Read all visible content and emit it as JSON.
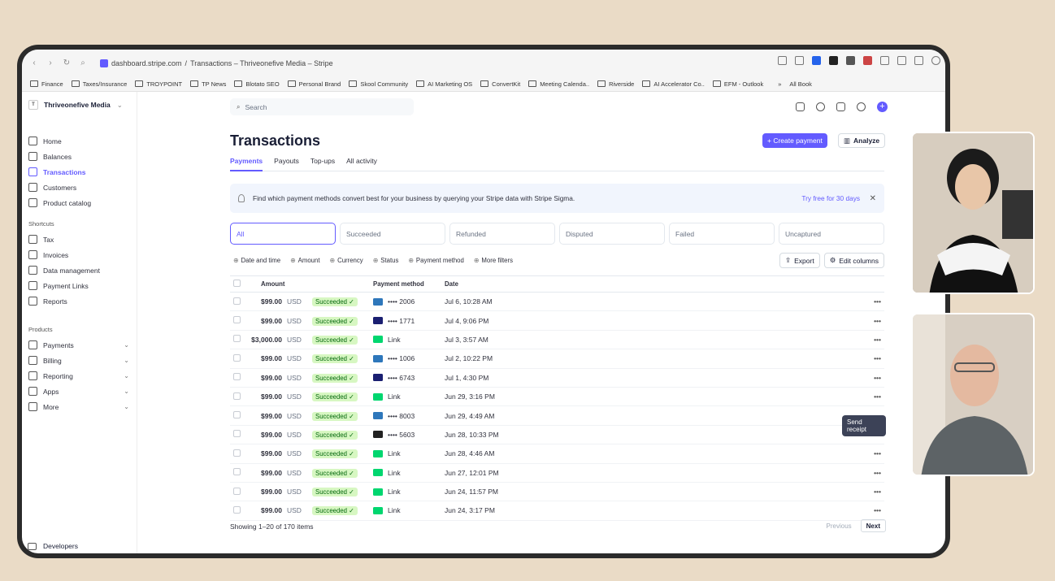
{
  "browser": {
    "url": "dashboard.stripe.com",
    "title": "Transactions – Thriveonefive Media – Stripe",
    "separator": "/"
  },
  "bookmarks": [
    "Finance",
    "Taxes/Insurance",
    "TROYPOINT",
    "TP News",
    "Blotato SEO",
    "Personal Brand",
    "Skool Community",
    "AI Marketing OS",
    "ConvertKit",
    "Meeting Calenda..",
    "Riverside",
    "AI Accelerator Co..",
    "EFM - Outlook"
  ],
  "bookmarks_more": "»",
  "bookmarks_all": "All Book",
  "account": {
    "initial": "T",
    "name": "Thriveonefive Media"
  },
  "nav": [
    "Home",
    "Balances",
    "Transactions",
    "Customers",
    "Product catalog"
  ],
  "shortcuts_label": "Shortcuts",
  "shortcuts": [
    "Tax",
    "Invoices",
    "Data management",
    "Payment Links",
    "Reports"
  ],
  "products_label": "Products",
  "products": [
    "Payments",
    "Billing",
    "Reporting",
    "Apps",
    "More"
  ],
  "developers": "Developers",
  "search_placeholder": "Search",
  "page_title": "Transactions",
  "create_payment": "+ Create payment",
  "analyze": "Analyze",
  "tabs": [
    "Payments",
    "Payouts",
    "Top-ups",
    "All activity"
  ],
  "banner": {
    "text": "Find which payment methods convert best for your business by querying your Stripe data with Stripe Sigma.",
    "link": "Try free for 30 days",
    "close": "✕"
  },
  "filters": [
    "All",
    "Succeeded",
    "Refunded",
    "Disputed",
    "Failed",
    "Uncaptured"
  ],
  "chips": [
    "Date and time",
    "Amount",
    "Currency",
    "Status",
    "Payment method",
    "More filters"
  ],
  "export": "Export",
  "edit_columns": "Edit columns",
  "columns": {
    "amount": "Amount",
    "method": "Payment method",
    "date": "Date"
  },
  "rows": [
    {
      "amount": "$99.00",
      "currency": "USD",
      "status": "Succeeded ✓",
      "method": "•••• 2006",
      "date": "Jul 6, 10:28 AM",
      "card": "#2e77bb"
    },
    {
      "amount": "$99.00",
      "currency": "USD",
      "status": "Succeeded ✓",
      "method": "•••• 1771",
      "date": "Jul 4, 9:06 PM",
      "card": "#1a1f71"
    },
    {
      "amount": "$3,000.00",
      "currency": "USD",
      "status": "Succeeded ✓",
      "method": "Link",
      "date": "Jul 3, 3:57 AM",
      "card": "#00d66f"
    },
    {
      "amount": "$99.00",
      "currency": "USD",
      "status": "Succeeded ✓",
      "method": "•••• 1006",
      "date": "Jul 2, 10:22 PM",
      "card": "#2e77bb"
    },
    {
      "amount": "$99.00",
      "currency": "USD",
      "status": "Succeeded ✓",
      "method": "•••• 6743",
      "date": "Jul 1, 4:30 PM",
      "card": "#1a1f71"
    },
    {
      "amount": "$99.00",
      "currency": "USD",
      "status": "Succeeded ✓",
      "method": "Link",
      "date": "Jun 29, 3:16 PM",
      "card": "#00d66f"
    },
    {
      "amount": "$99.00",
      "currency": "USD",
      "status": "Succeeded ✓",
      "method": "•••• 8003",
      "date": "Jun 29, 4:49 AM",
      "card": "#2e77bb"
    },
    {
      "amount": "$99.00",
      "currency": "USD",
      "status": "Succeeded ✓",
      "method": "•••• 5603",
      "date": "Jun 28, 10:33 PM",
      "card": "#222222"
    },
    {
      "amount": "$99.00",
      "currency": "USD",
      "status": "Succeeded ✓",
      "method": "Link",
      "date": "Jun 28, 4:46 AM",
      "card": "#00d66f"
    },
    {
      "amount": "$99.00",
      "currency": "USD",
      "status": "Succeeded ✓",
      "method": "Link",
      "date": "Jun 27, 12:01 PM",
      "card": "#00d66f"
    },
    {
      "amount": "$99.00",
      "currency": "USD",
      "status": "Succeeded ✓",
      "method": "Link",
      "date": "Jun 24, 11:57 PM",
      "card": "#00d66f"
    },
    {
      "amount": "$99.00",
      "currency": "USD",
      "status": "Succeeded ✓",
      "method": "Link",
      "date": "Jun 24, 3:17 PM",
      "card": "#00d66f"
    }
  ],
  "row_more": "•••",
  "tooltip": "Send receipt",
  "footer": "Showing 1–20 of 170 items",
  "previous": "Previous",
  "next": "Next"
}
